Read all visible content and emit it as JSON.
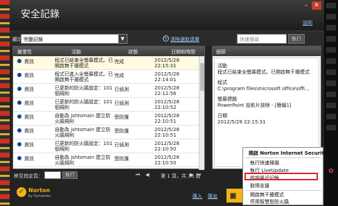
{
  "window": {
    "title": "安全記錄",
    "help": "說明"
  },
  "toolbar": {
    "show_label": "顯示",
    "filter_value": "完整記錄",
    "clear_link": "清除選取清單",
    "search_placeholder": "快速搜尋",
    "search_button": "執行"
  },
  "table": {
    "headers": [
      "嚴重性",
      "活動",
      "狀態",
      "日期和時間"
    ],
    "rows": [
      {
        "severity": "資訊",
        "activity": "程式已結束全螢幕模式。已開啟無干擾模式",
        "status": "完成",
        "date": "2012/5/28",
        "time": "22:15:31",
        "selected": true
      },
      {
        "severity": "資訊",
        "activity": "程式已進入全螢幕模式。已開啟無干擾模式",
        "status": "完成",
        "date": "2012/5/28",
        "time": "22:14:01",
        "selected": false
      },
      {
        "severity": "資訊",
        "activity": "已更新的防火牆設定：101 個規則",
        "status": "已偵測",
        "date": "2012/5/28",
        "time": "22:12:56",
        "selected": false
      },
      {
        "severity": "資訊",
        "activity": "已更新的防火牆設定：101 個規則",
        "status": "已偵測",
        "date": "2012/5/28",
        "time": "22:10:52",
        "selected": false
      },
      {
        "severity": "資訊",
        "activity": "自動為 jshtsmain 建立防火牆規則",
        "status": "受防護",
        "date": "2012/5/28",
        "time": "22:10:51",
        "selected": false
      },
      {
        "severity": "資訊",
        "activity": "自動為 jshtsmain 建立防火牆規則",
        "status": "受防護",
        "date": "2012/5/28",
        "time": "22:10:51",
        "selected": false
      },
      {
        "severity": "資訊",
        "activity": "已更新的防火牆設定：101 個規則",
        "status": "已偵測",
        "date": "2012/5/28",
        "time": "22:10:50",
        "selected": false
      },
      {
        "severity": "資訊",
        "activity": "自動為 jshtsmain 建立防火牆規則",
        "status": "受防護",
        "date": "2012/5/28",
        "time": "22:10:50",
        "selected": false
      }
    ]
  },
  "pager": {
    "goto_label": "移至指定頁：",
    "goto_button": "執行",
    "page_text": "第 1 頁，共 36 頁"
  },
  "details": {
    "title": "細節",
    "fields": [
      {
        "label": "活動",
        "value": "程式已結束全螢幕模式。已開啟無干擾模式"
      },
      {
        "label": "程式",
        "value": "C:\\program files\\microsoft office\\offi..."
      },
      {
        "label": "螢幕標題",
        "value": "PowerPoint 投影片放映 - [簡報1]"
      },
      {
        "label": "日期",
        "value": "2012/5/28 22:15:31"
      }
    ]
  },
  "footer": {
    "brand": "Norton",
    "brand_sub": "by Symantec",
    "import_link": "匯入",
    "export_link": "匯出",
    "main_button": "關"
  },
  "context_menu": {
    "header": "開啟 Norton Internet Security",
    "items": [
      "執行快速掃描",
      "執行 LiveUpdate",
      "檢視最近記錄",
      "取得支援",
      "開啟無干擾模式",
      "停用智慧型防火牆"
    ],
    "highlighted_index": 2
  },
  "colors": {
    "accent": "#f3b416",
    "link": "#9fd0ff",
    "highlight_border": "#e02020",
    "severity_dot": "#1a3d9a"
  }
}
